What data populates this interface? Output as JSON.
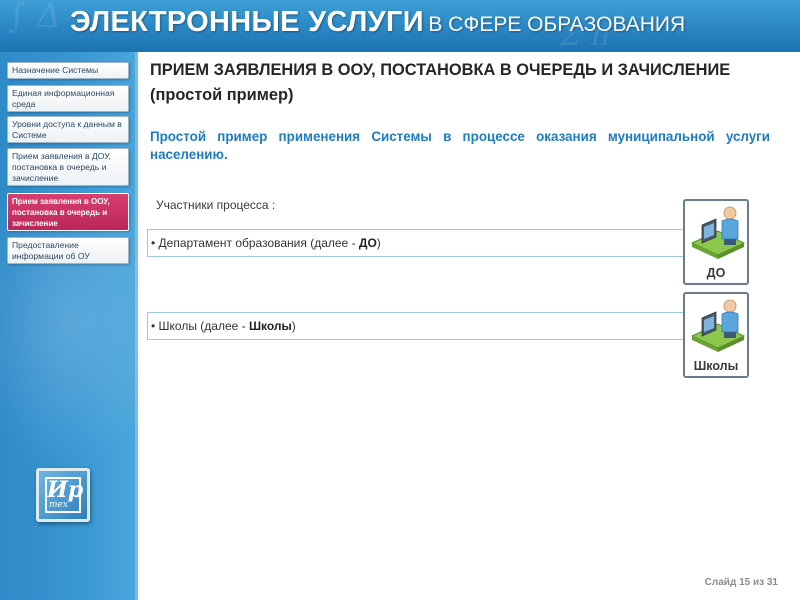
{
  "header": {
    "title_main": "ЭЛЕКТРОННЫЕ УСЛУГИ",
    "title_sub": "В СФЕРЕ ОБРАЗОВАНИЯ"
  },
  "sidebar": {
    "items": [
      {
        "label": "Назначение Системы",
        "active": false
      },
      {
        "label": "Единая информационная среда",
        "active": false
      },
      {
        "label": "Уровни доступа к данным в Системе",
        "active": false
      },
      {
        "label": "Прием заявления в ДОУ, постановка в очередь и зачисление",
        "active": false
      },
      {
        "label": "Прием заявления в ООУ, постановка в очередь и зачисление",
        "active": true
      },
      {
        "label": "Предоставление информации об ОУ",
        "active": false
      }
    ],
    "logo": {
      "letters": "Ир",
      "sub": "тех"
    }
  },
  "main": {
    "heading": "ПРИЕМ ЗАЯВЛЕНИЯ В ООУ, ПОСТАНОВКА В ОЧЕРЕДЬ И ЗАЧИСЛЕНИЕ (простой пример)",
    "subheading": "Простой пример применения Системы в процессе оказания муниципальной услуги населению.",
    "participants_label": "Участники процесса :",
    "participants": [
      {
        "prefix": "• Департамент образования (далее - ",
        "bold": "ДО",
        "suffix": ")",
        "actor_label": "ДО"
      },
      {
        "prefix": "• Школы (далее - ",
        "bold": "Школы",
        "suffix": ")",
        "actor_label": "Школы"
      }
    ]
  },
  "footer": {
    "slide_counter": "Слайд 15 из 31"
  },
  "colors": {
    "header_blue": "#2a86c4",
    "sidebar_blue": "#3a98d4",
    "active_item": "#c42f62",
    "subheading_blue": "#1e7cc0",
    "actor_desk": "#7fbf3f",
    "actor_person": "#5aa6dc"
  },
  "icons": [
    "person-at-computer-icon"
  ]
}
